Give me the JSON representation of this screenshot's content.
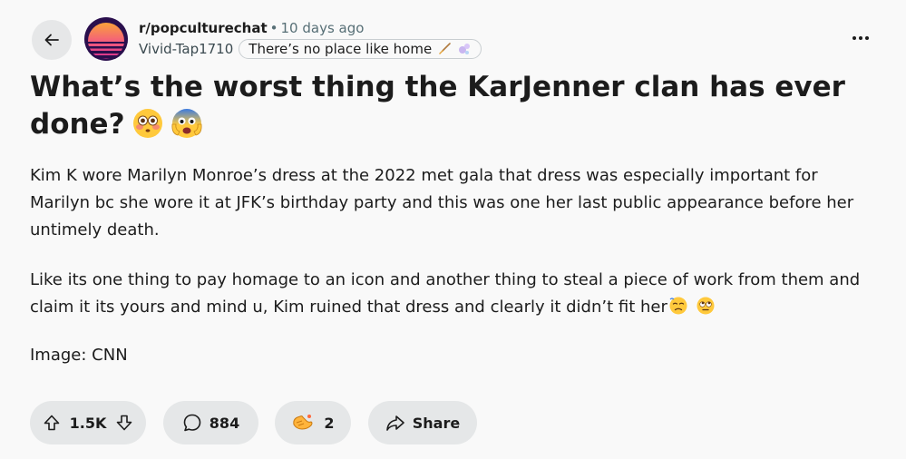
{
  "post": {
    "subreddit": "r/popculturechat",
    "separator": "•",
    "time_ago": "10 days ago",
    "author": "Vivid-Tap1710",
    "flair": "There’s no place like home",
    "title": "What’s the worst thing the KarJenner clan has ever done?",
    "paragraphs": [
      "Kim K wore Marilyn Monroe’s dress at the 2022 met gala that dress was especially important for Marilyn bc she wore it at JFK’s birthday party and this was one her last public appearance before her untimely death.",
      "Like its one thing to pay homage to an icon and another thing to steal a piece of work from them and claim it its yours and mind u, Kim ruined that dress and clearly it didn’t fit her",
      "Image: CNN"
    ]
  },
  "actions": {
    "votes": "1.5K",
    "comments": "884",
    "awards": "2",
    "share_label": "Share"
  },
  "icons": {
    "back": "arrow-left-icon",
    "more": "more-options-icon",
    "upvote": "upvote-arrow-icon",
    "downvote": "downvote-arrow-icon",
    "comment": "comment-bubble-icon",
    "award": "award-icon",
    "share": "share-arrow-icon"
  },
  "colors": {
    "background": "#f9f9f9",
    "button_bg": "#e5e7e8",
    "meta_gray": "#576f76"
  }
}
